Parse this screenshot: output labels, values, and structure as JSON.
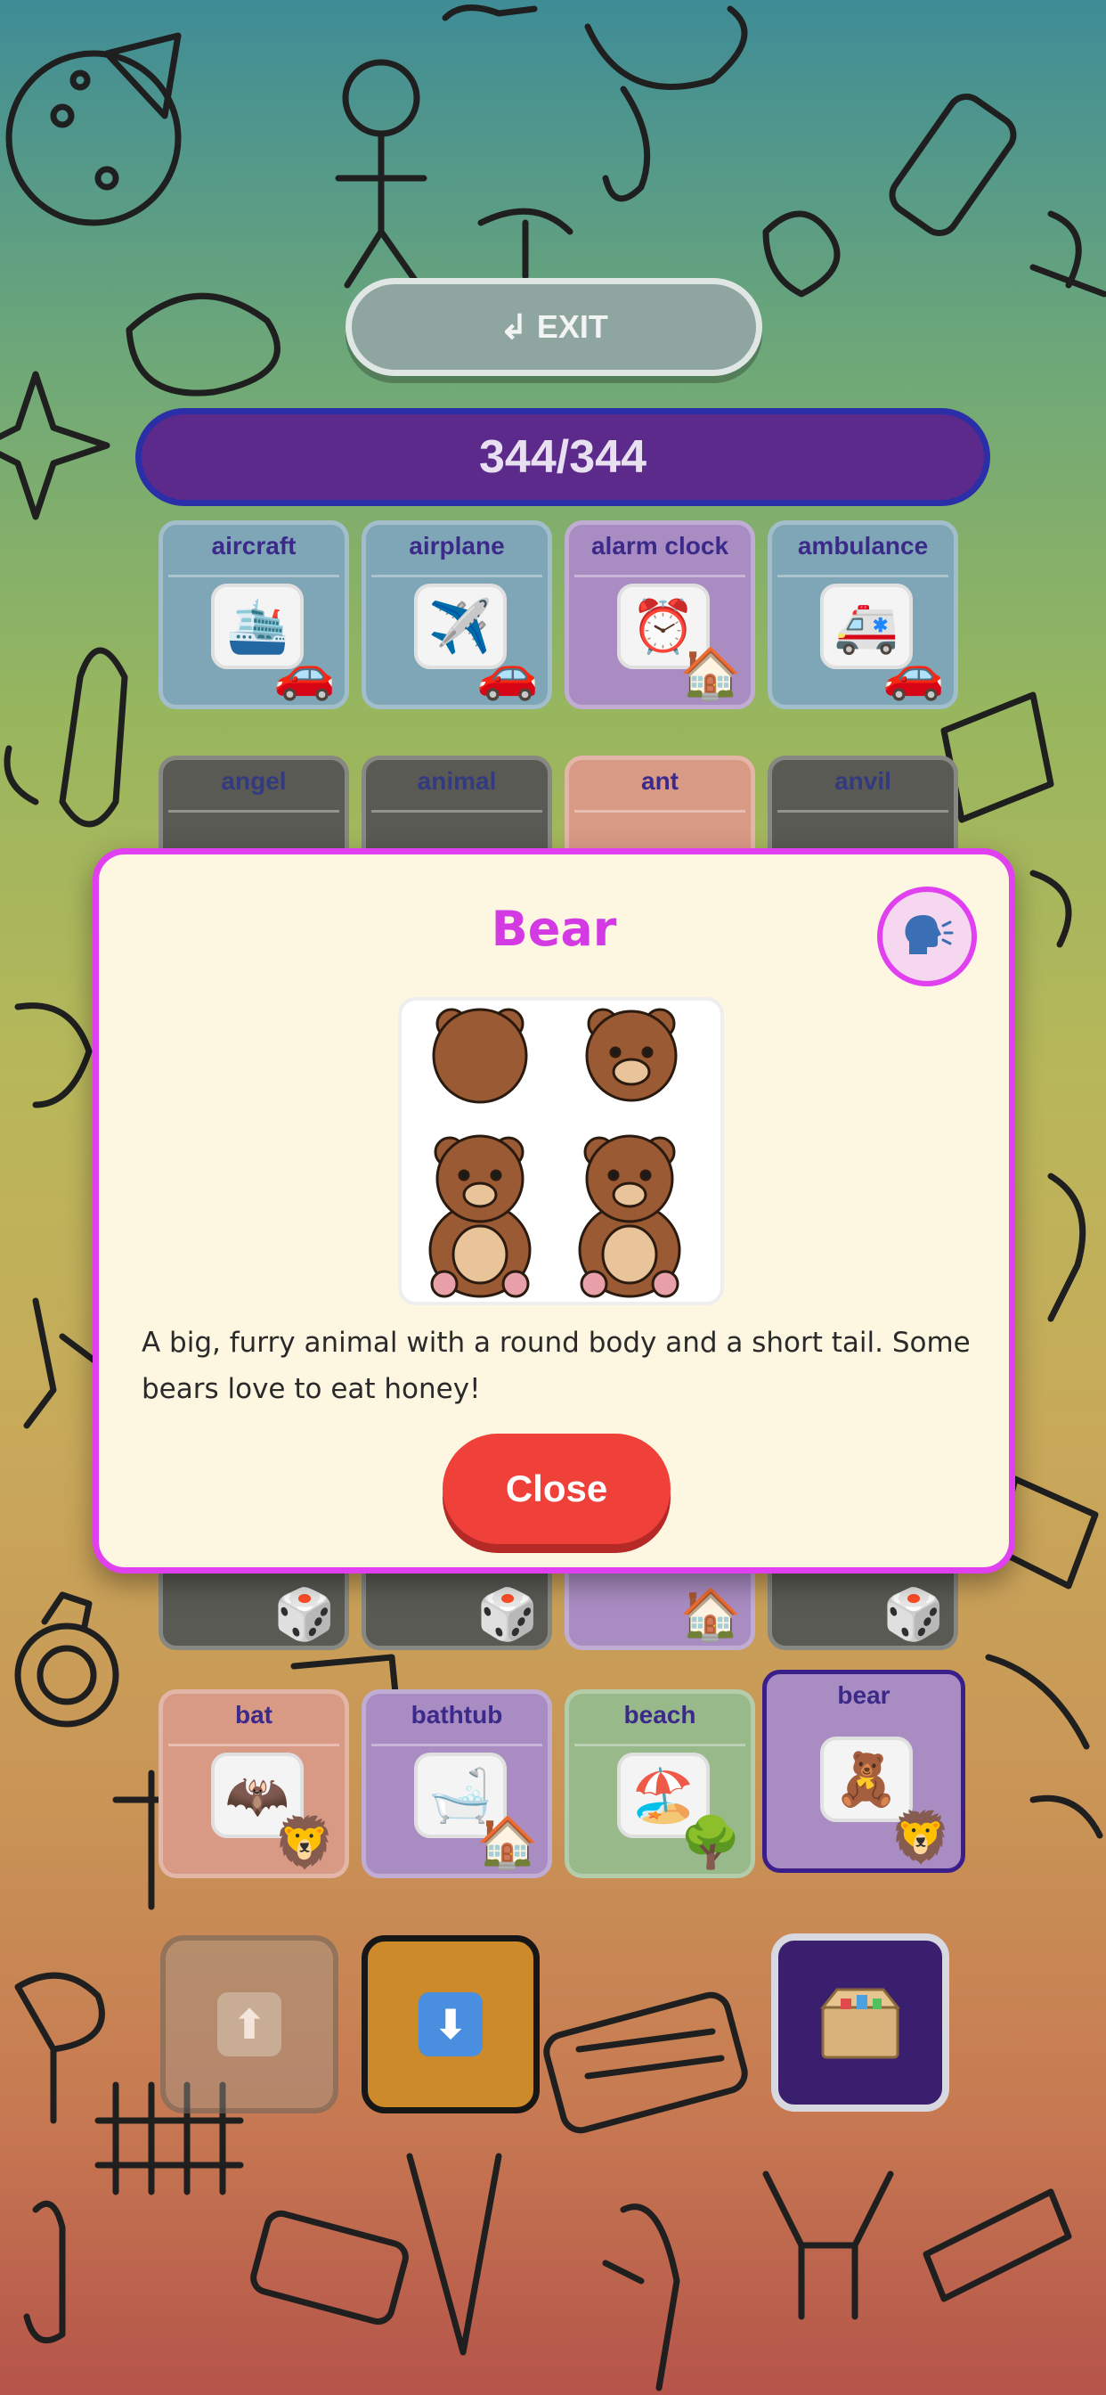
{
  "header": {
    "exit_label": "EXIT",
    "exit_icon": "return-arrow-icon",
    "progress": "344/344"
  },
  "grid_rows": [
    [
      {
        "label": "aircraft",
        "icon": "ship",
        "category_icon": "car",
        "tint": "blue"
      },
      {
        "label": "airplane",
        "icon": "airplane",
        "category_icon": "car",
        "tint": "blue"
      },
      {
        "label": "alarm clock",
        "icon": "alarm-clock",
        "category_icon": "house",
        "tint": "purple"
      },
      {
        "label": "ambulance",
        "icon": "ambulance",
        "category_icon": "car",
        "tint": "blue"
      }
    ],
    [
      {
        "label": "angel",
        "tint": "dark"
      },
      {
        "label": "animal",
        "tint": "dark"
      },
      {
        "label": "ant",
        "tint": "peach"
      },
      {
        "label": "anvil",
        "tint": "dark"
      }
    ],
    [
      {
        "label": "bat",
        "icon": "bat",
        "category_icon": "lion",
        "tint": "peach"
      },
      {
        "label": "bathtub",
        "icon": "bathtub",
        "category_icon": "house",
        "tint": "purple"
      },
      {
        "label": "beach",
        "icon": "beach",
        "category_icon": "tree",
        "tint": "green"
      },
      {
        "label": "bear",
        "icon": "bear",
        "category_icon": "lion",
        "tint": "selected"
      }
    ]
  ],
  "modal": {
    "title": "Bear",
    "speak_icon": "speaking-head-icon",
    "description": "A big, furry animal with a round body and a short tail. Some bears love to eat honey!",
    "close_label": "Close"
  },
  "controls": {
    "up_icon": "up-arrow-icon",
    "down_icon": "down-arrow-icon",
    "box_icon": "box-icon"
  },
  "colors": {
    "modal_border": "#e040f0",
    "title": "#d43ae4",
    "close_button": "#f0403a",
    "counter_bg": "#5b2a8b"
  }
}
